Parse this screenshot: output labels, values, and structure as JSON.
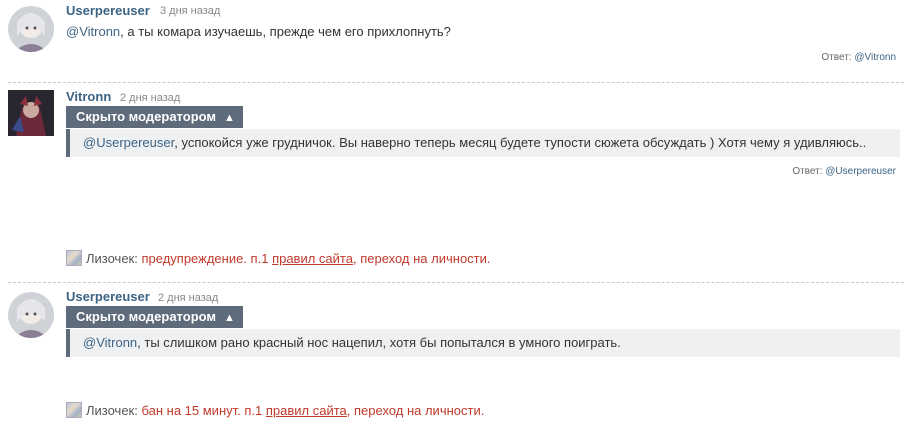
{
  "comments": [
    {
      "author": "Userpereuser",
      "time": "3 дня назад",
      "mention": "@Vitronn",
      "text": ", а ты комара изучаешь, прежде чем его прихлопнуть?",
      "reply_label": "Ответ:",
      "reply_to": "@Vitronn"
    },
    {
      "author": "Vitronn",
      "time": "2 дня назад",
      "hidden_label": "Скрыто модератором",
      "mention": "@Userpereuser",
      "text": ", успокойся уже грудничок. Вы наверно теперь месяц будете тупости сюжета обсуждать ) Хотя чему я удивляюсь..",
      "reply_label": "Ответ:",
      "reply_to": "@Userpereuser",
      "moderator": "Лизочек:",
      "mod_action": "предупреждение. п.1",
      "rules_link": "правил сайта",
      "mod_reason": ", переход на личности."
    },
    {
      "author": "Userpereuser",
      "time": "2 дня назад",
      "hidden_label": "Скрыто модератором",
      "mention": "@Vitronn",
      "text": ", ты слишком рано красный нос нацепил, хотя бы попытался в умного поиграть.",
      "moderator": "Лизочек:",
      "mod_action": "бан на 15 минут. п.1",
      "rules_link": "правил сайта",
      "mod_reason": ", переход на личности."
    }
  ],
  "icons": {
    "collapse": "chevron-up-icon",
    "moderator": "moderator-avatar-icon"
  },
  "colors": {
    "author": "#3d6485",
    "moderator_tab": "#5d6b7a",
    "moderation_note": "#c0392b"
  }
}
